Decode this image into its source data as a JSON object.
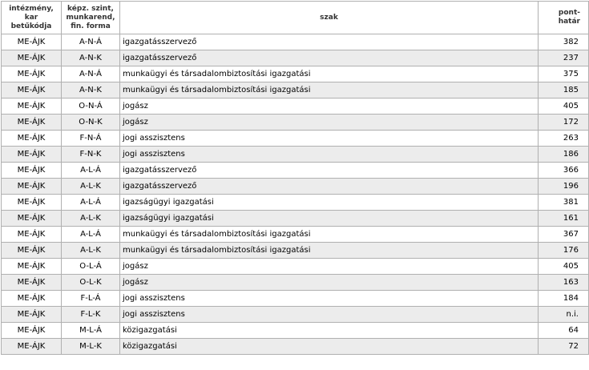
{
  "table": {
    "headers": {
      "institution": "intézmény, kar betűkódja",
      "level": "képz. szint, munkarend, fin. forma",
      "major": "szak",
      "points": "pont-határ"
    },
    "rows": [
      {
        "institution": "ME-ÁJK",
        "level": "A-N-Á",
        "major": "igazgatásszervező",
        "points": "382"
      },
      {
        "institution": "ME-ÁJK",
        "level": "A-N-K",
        "major": "igazgatásszervező",
        "points": "237"
      },
      {
        "institution": "ME-ÁJK",
        "level": "A-N-Á",
        "major": "munkaügyi és társadalombiztosítási igazgatási",
        "points": "375"
      },
      {
        "institution": "ME-ÁJK",
        "level": "A-N-K",
        "major": "munkaügyi és társadalombiztosítási igazgatási",
        "points": "185"
      },
      {
        "institution": "ME-ÁJK",
        "level": "O-N-Á",
        "major": "jogász",
        "points": "405"
      },
      {
        "institution": "ME-ÁJK",
        "level": "O-N-K",
        "major": "jogász",
        "points": "172"
      },
      {
        "institution": "ME-ÁJK",
        "level": "F-N-Á",
        "major": "jogi asszisztens",
        "points": "263"
      },
      {
        "institution": "ME-ÁJK",
        "level": "F-N-K",
        "major": "jogi asszisztens",
        "points": "186"
      },
      {
        "institution": "ME-ÁJK",
        "level": "A-L-Á",
        "major": "igazgatásszervező",
        "points": "366"
      },
      {
        "institution": "ME-ÁJK",
        "level": "A-L-K",
        "major": "igazgatásszervező",
        "points": "196"
      },
      {
        "institution": "ME-ÁJK",
        "level": "A-L-Á",
        "major": "igazságügyi igazgatási",
        "points": "381"
      },
      {
        "institution": "ME-ÁJK",
        "level": "A-L-K",
        "major": "igazságügyi igazgatási",
        "points": "161"
      },
      {
        "institution": "ME-ÁJK",
        "level": "A-L-Á",
        "major": "munkaügyi és társadalombiztosítási igazgatási",
        "points": "367"
      },
      {
        "institution": "ME-ÁJK",
        "level": "A-L-K",
        "major": "munkaügyi és társadalombiztosítási igazgatási",
        "points": "176"
      },
      {
        "institution": "ME-ÁJK",
        "level": "O-L-Á",
        "major": "jogász",
        "points": "405"
      },
      {
        "institution": "ME-ÁJK",
        "level": "O-L-K",
        "major": "jogász",
        "points": "163"
      },
      {
        "institution": "ME-ÁJK",
        "level": "F-L-Á",
        "major": "jogi asszisztens",
        "points": "184"
      },
      {
        "institution": "ME-ÁJK",
        "level": "F-L-K",
        "major": "jogi asszisztens",
        "points": "n.i."
      },
      {
        "institution": "ME-ÁJK",
        "level": "M-L-Á",
        "major": "közigazgatási",
        "points": "64"
      },
      {
        "institution": "ME-ÁJK",
        "level": "M-L-K",
        "major": "közigazgatási",
        "points": "72"
      }
    ]
  }
}
